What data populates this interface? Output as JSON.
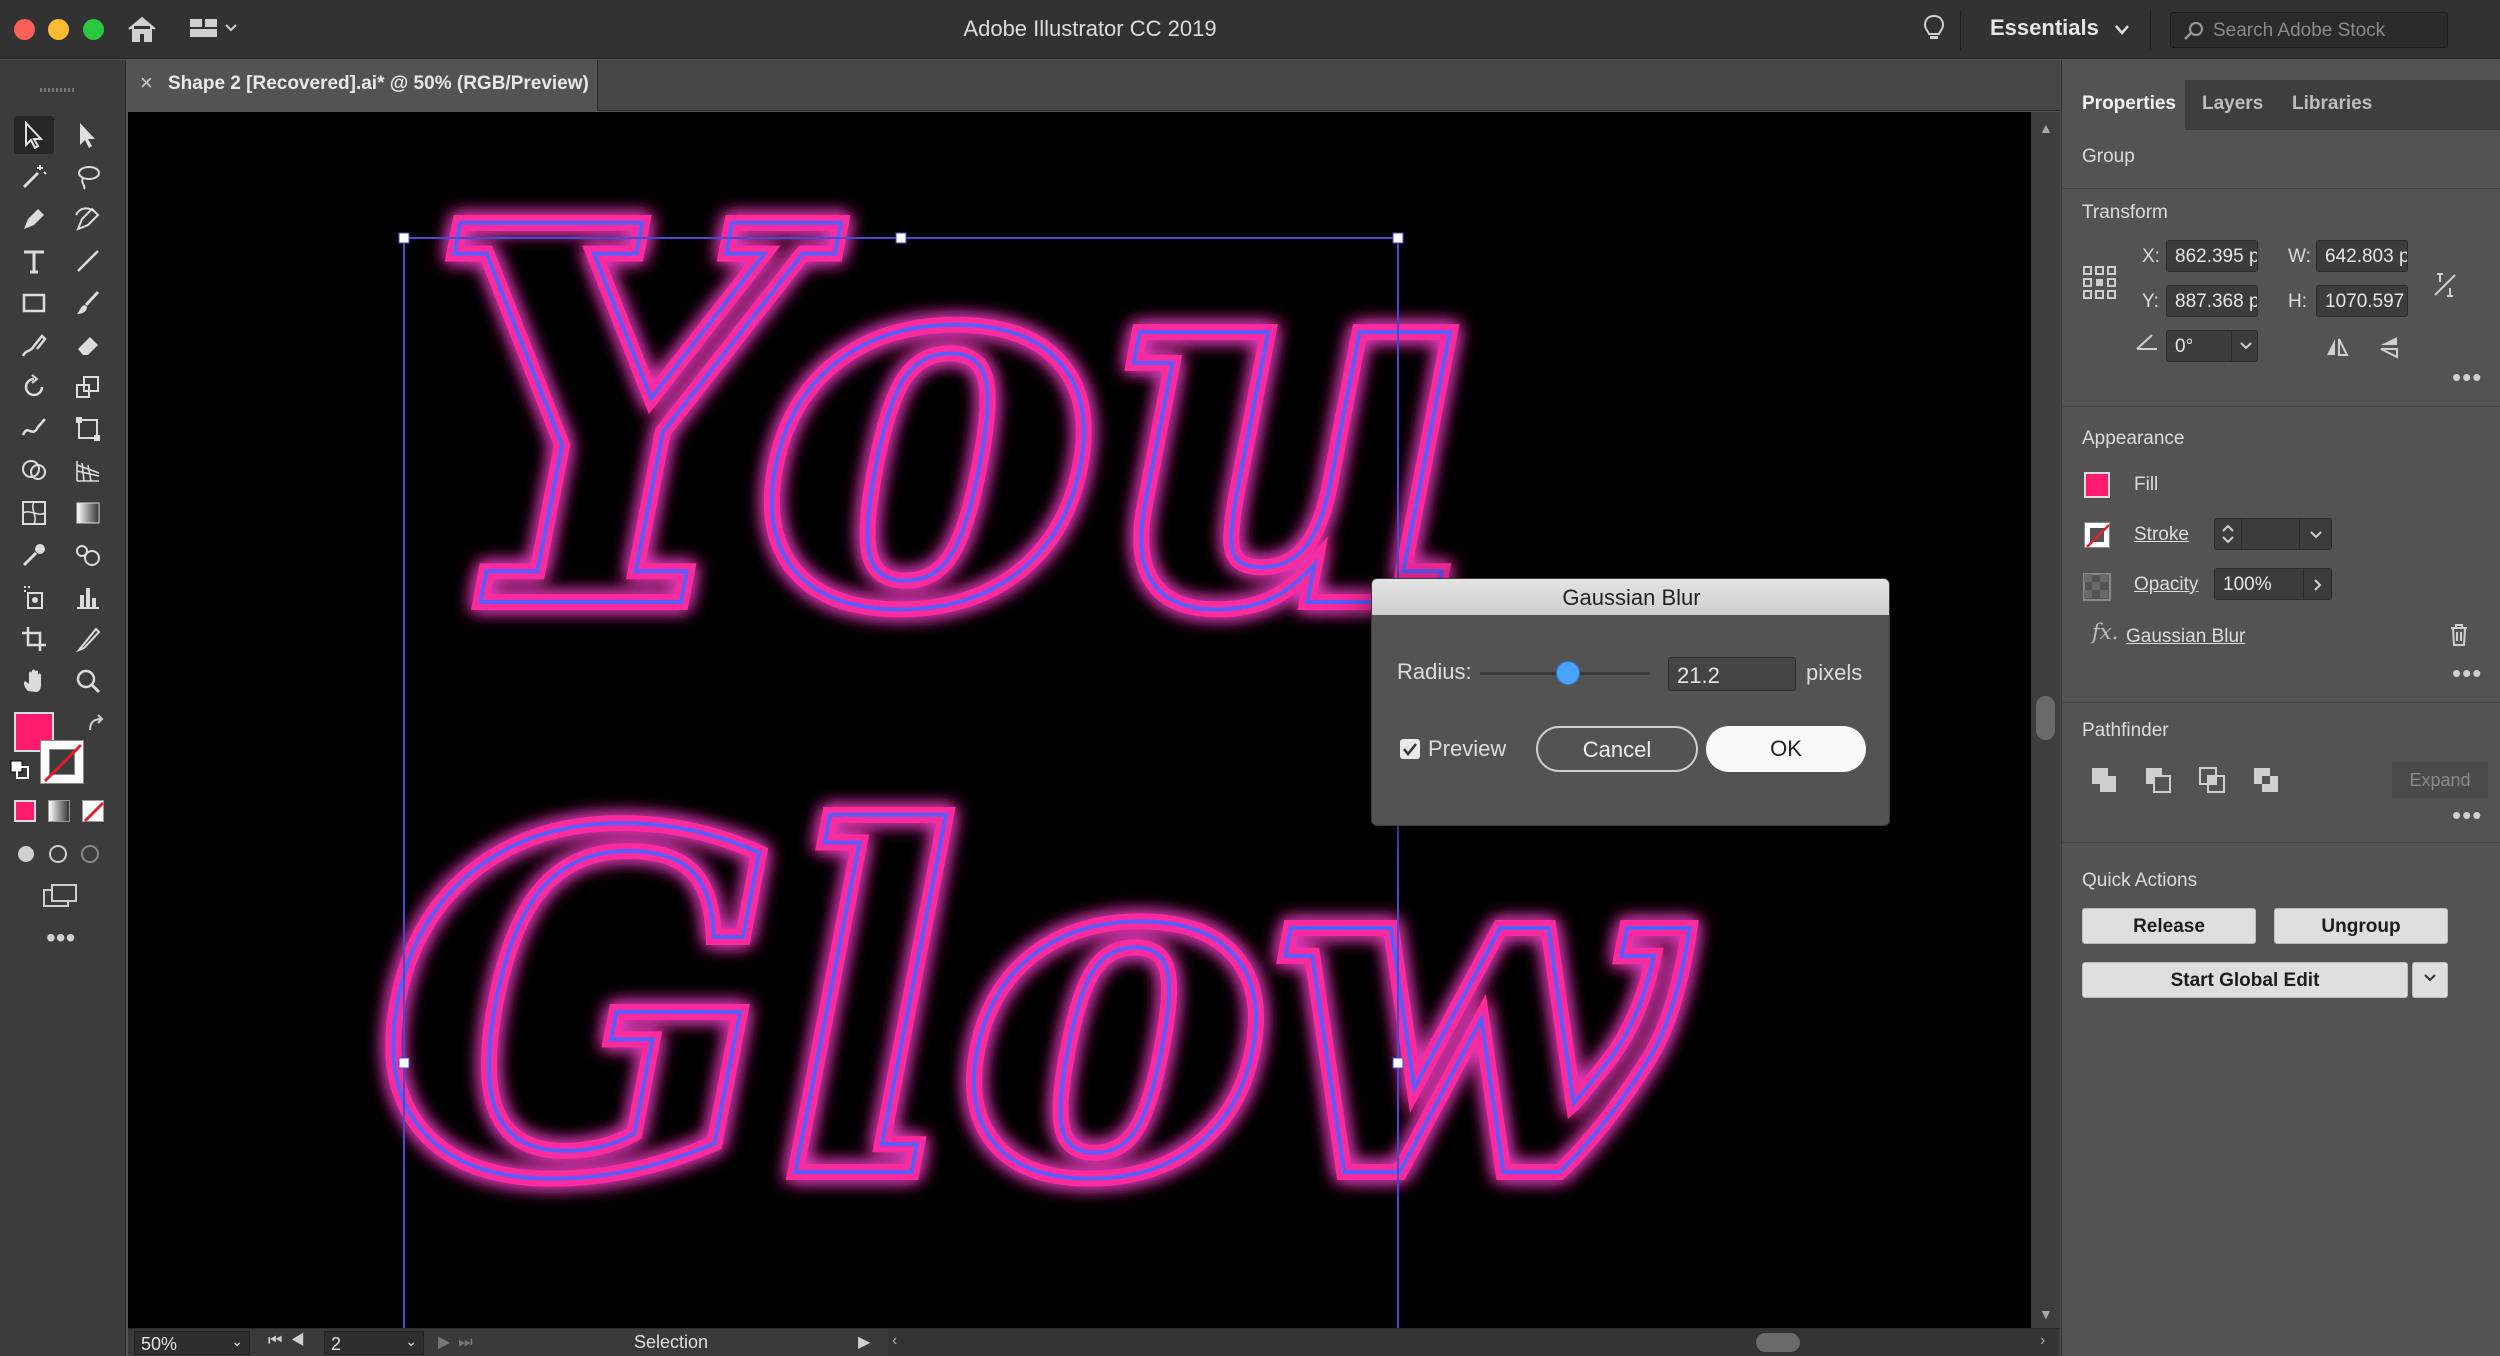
{
  "app": {
    "title": "Adobe Illustrator CC 2019"
  },
  "header": {
    "workspace": "Essentials",
    "search_placeholder": "Search Adobe Stock"
  },
  "document": {
    "tab_label": "Shape 2 [Recovered].ai* @ 50% (RGB/Preview)"
  },
  "artwork": {
    "line1": "You",
    "line2": "Glow",
    "neon_color": "#ff2a9d",
    "inner_color": "#5a5dff"
  },
  "colors": {
    "fill": "#ff1a6e",
    "selection": "#4a4ad0",
    "accent": "#4aa3ff"
  },
  "dialog": {
    "title": "Gaussian Blur",
    "radius_label": "Radius:",
    "radius_value": "21.2",
    "radius_unit": "pixels",
    "preview_label": "Preview",
    "preview_checked": true,
    "cancel_label": "Cancel",
    "ok_label": "OK"
  },
  "panel": {
    "tabs": [
      "Properties",
      "Layers",
      "Libraries"
    ],
    "selection_type": "Group",
    "transform": {
      "title": "Transform",
      "x_label": "X:",
      "x_value": "862.395 p",
      "y_label": "Y:",
      "y_value": "887.368 p",
      "w_label": "W:",
      "w_value": "642.803 p",
      "h_label": "H:",
      "h_value": "1070.597",
      "angle_value": "0°"
    },
    "appearance": {
      "title": "Appearance",
      "fill_label": "Fill",
      "stroke_label": "Stroke",
      "opacity_label": "Opacity",
      "opacity_value": "100%",
      "effect_label": "Gaussian Blur"
    },
    "pathfinder": {
      "title": "Pathfinder",
      "expand_label": "Expand"
    },
    "quick_actions": {
      "title": "Quick Actions",
      "release_label": "Release",
      "ungroup_label": "Ungroup",
      "global_edit_label": "Start Global Edit"
    }
  },
  "statusbar": {
    "zoom": "50%",
    "artboard": "2",
    "tool": "Selection"
  }
}
